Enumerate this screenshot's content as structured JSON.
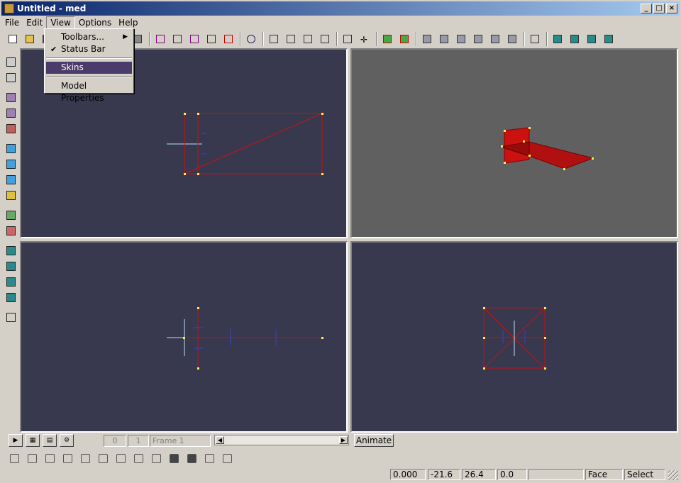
{
  "window": {
    "title": "Untitled - med",
    "buttons": [
      "_",
      "□",
      "×"
    ]
  },
  "menubar": {
    "file": "File",
    "edit": "Edit",
    "view": "View",
    "options": "Options",
    "help": "Help"
  },
  "view_menu": {
    "toolbars": "Toolbars...",
    "status_bar": "Status Bar",
    "status_bar_checked": true,
    "skins": "Skins",
    "model_properties": "Model Properties"
  },
  "toolbar": {
    "icons": [
      "new-icon",
      "open-icon",
      "save-icon",
      "undo-icon",
      "redo-icon",
      "select-vertex-icon",
      "select-face-icon",
      "select-object-icon",
      "box-select-icon",
      "move-select-icon",
      "rotate-select-icon",
      "scale-select-icon",
      "rotate-view-icon",
      "pan-view-icon",
      "zoom-icon",
      "zoom-region-icon",
      "fit-icon",
      "move-icon",
      "vertex-tool-icon",
      "face-tool-icon",
      "weld-icon",
      "grid-icon",
      "snap-icon",
      "mirror-icon",
      "triangle-icon",
      "flip-icon",
      "quad-icon",
      "view-front-icon",
      "view-side-icon",
      "view-top-icon",
      "view-3d-icon"
    ]
  },
  "animation": {
    "frame_start": "0",
    "frame_current": "1",
    "frame_name": "Frame 1",
    "animate_label": "Animate"
  },
  "status": {
    "x": "0.000",
    "y": "-21.6",
    "z": "26.4",
    "w": "0.0",
    "blank": "",
    "mode": "Face",
    "tool": "Select"
  },
  "colors": {
    "viewport_bg": "#38384e",
    "persp_bg": "#606060",
    "mesh_red": "#cc1111",
    "vertex_yellow": "#ffee44",
    "menu_highlight": "#4b3a6a"
  }
}
